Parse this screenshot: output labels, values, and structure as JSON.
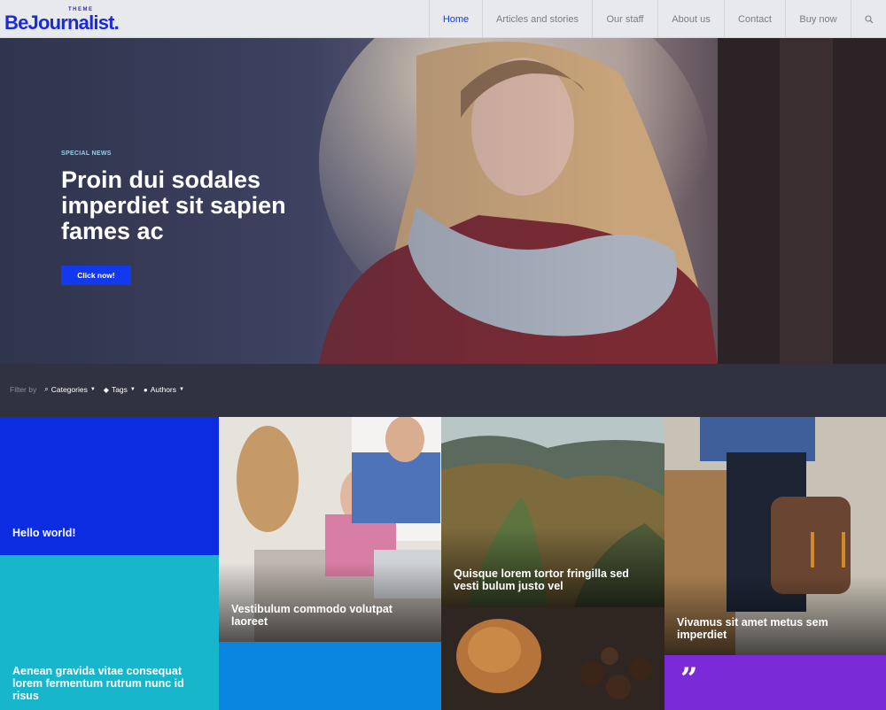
{
  "header": {
    "logo_small": "THEME",
    "logo_text": "BeJournalist.",
    "nav": [
      "Home",
      "Articles and stories",
      "Our staff",
      "About us",
      "Contact",
      "Buy now"
    ],
    "search_icon": "search-icon"
  },
  "hero": {
    "kicker": "SPECIAL NEWS",
    "title": "Proin dui sodales imperdiet sit sapien fames ac",
    "button": "Click now!"
  },
  "filter": {
    "label": "Filter by",
    "items": [
      "Categories",
      "Tags",
      "Authors"
    ]
  },
  "tiles": {
    "hello": "Hello world!",
    "aenean": "Aenean gravida vitae consequat lorem fermentum rutrum nunc id risus",
    "vest": "Vestibulum commodo volutpat laoreet",
    "quis": "Quisque lorem tortor fringilla sed vesti bulum justo vel",
    "viv": "Vivamus sit amet metus sem imperdiet",
    "quote": "”"
  },
  "colors": {
    "accent": "#1239f0",
    "tile_blue": "#0b2ce0",
    "tile_teal": "#17b6cb",
    "tile_sky": "#0b86e0",
    "tile_purple": "#7a2ad6",
    "filter_bg": "#30323f"
  }
}
